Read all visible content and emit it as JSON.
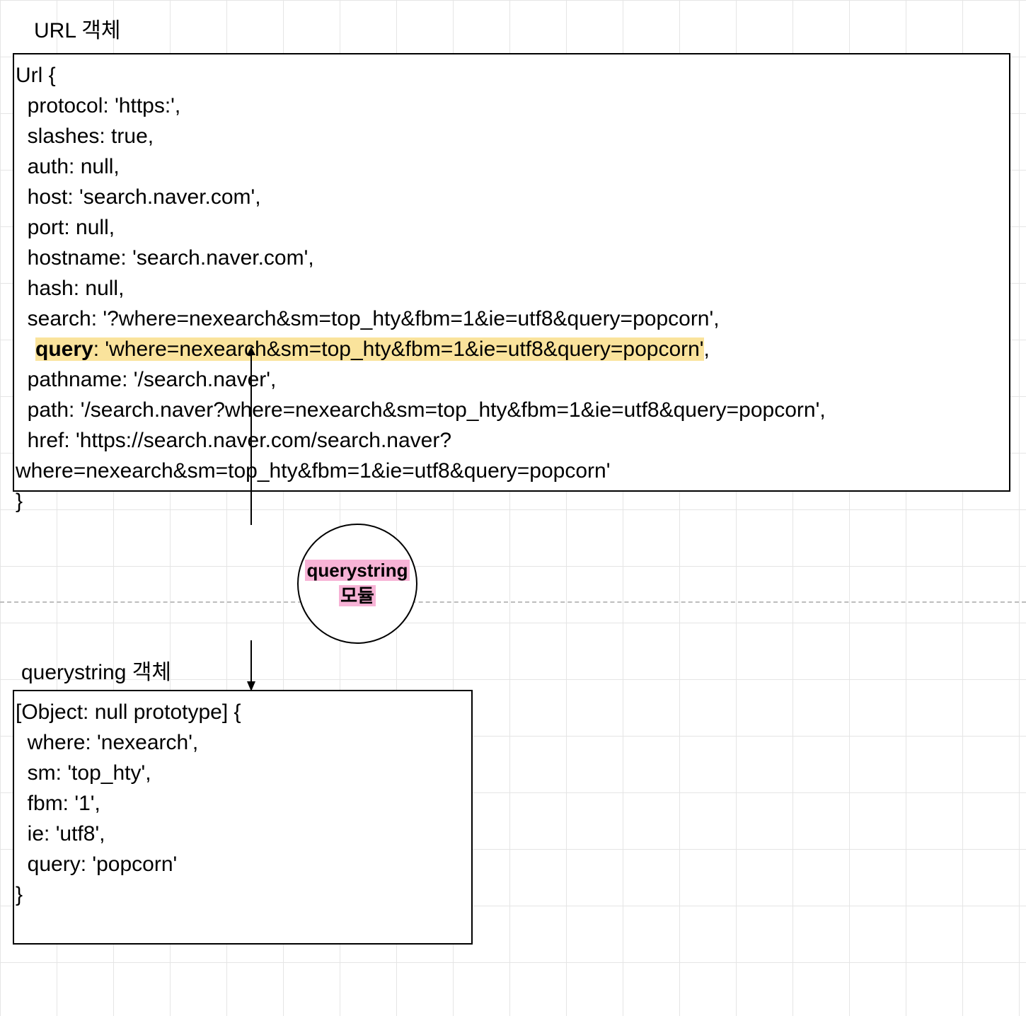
{
  "labels": {
    "url_object": "URL 객체",
    "qs_object": "querystring 객체"
  },
  "circle": {
    "line1": "querystring",
    "line2": "모듈"
  },
  "url": {
    "header": "Url {",
    "protocol": "  protocol: 'https:',",
    "slashes": "  slashes: true,",
    "auth": "  auth: null,",
    "host": "  host: 'search.naver.com',",
    "port": "  port: null,",
    "hostname": "  hostname: 'search.naver.com',",
    "hash": "  hash: null,",
    "search": "  search: '?where=nexearch&sm=top_hty&fbm=1&ie=utf8&query=popcorn',",
    "query_key": "query",
    "query_rest": ": 'where=nexearch&sm=top_hty&fbm=1&ie=utf8&query=popcorn'",
    "query_trailing": ",",
    "pathname": "  pathname: '/search.naver',",
    "path": "  path: '/search.naver?where=nexearch&sm=top_hty&fbm=1&ie=utf8&query=popcorn',",
    "href1": "  href: 'https://search.naver.com/search.naver?",
    "href2": "where=nexearch&sm=top_hty&fbm=1&ie=utf8&query=popcorn'",
    "footer": "}"
  },
  "qs": {
    "header": "[Object: null prototype] {",
    "where": "  where: 'nexearch',",
    "sm": "  sm: 'top_hty',",
    "fbm": "  fbm: '1',",
    "ie": "  ie: 'utf8',",
    "query": "  query: 'popcorn'",
    "footer": "}"
  }
}
